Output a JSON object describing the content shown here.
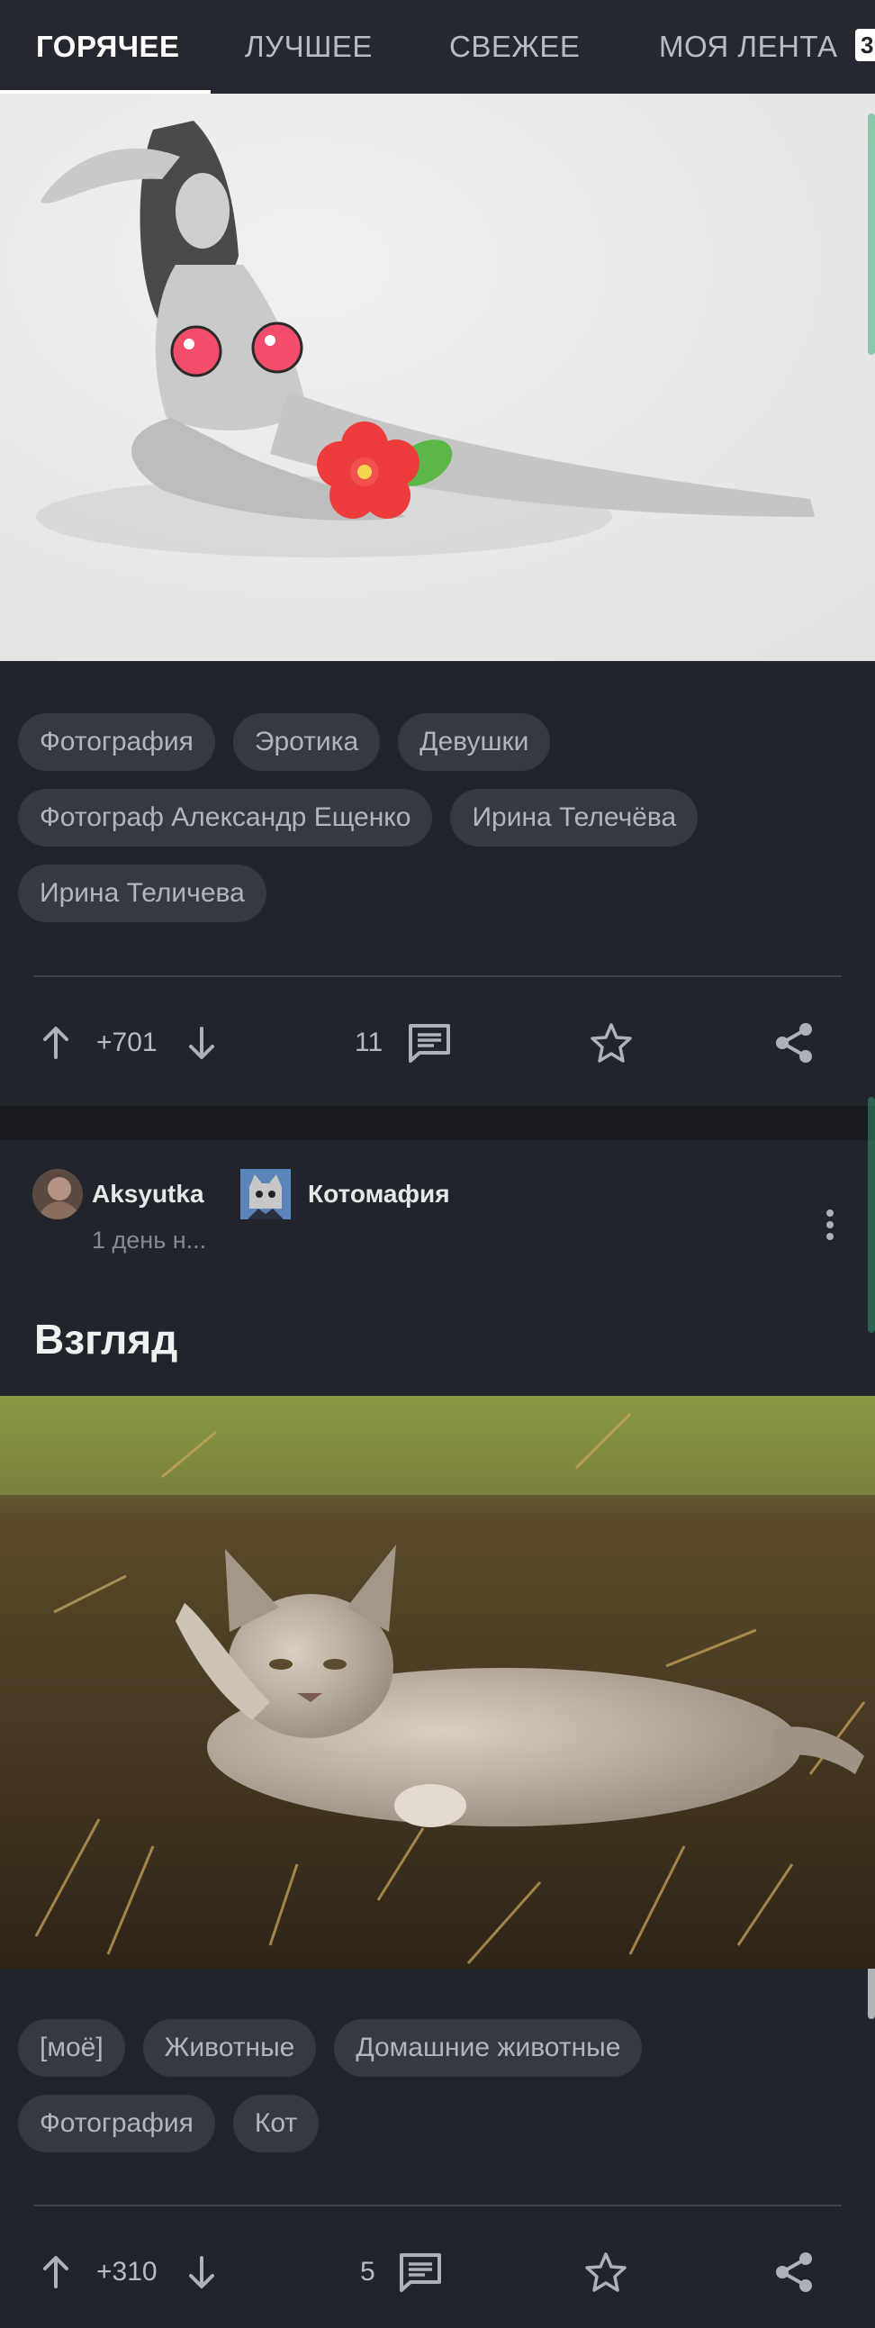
{
  "tabs": [
    {
      "label": "ГОРЯЧЕЕ",
      "active": true
    },
    {
      "label": "ЛУЧШЕЕ",
      "active": false
    },
    {
      "label": "СВЕЖЕЕ",
      "active": false
    },
    {
      "label": "МОЯ ЛЕНТА",
      "active": false
    }
  ],
  "tab_badge": "3",
  "posts": [
    {
      "tags": [
        "Фотография",
        "Эротика",
        "Девушки",
        "Фотограф Александр Ещенко",
        "Ирина Телечёва",
        "Ирина Теличева"
      ],
      "rating": "+701",
      "comments": "11"
    },
    {
      "author": "Aksyutka",
      "community": "Котомафия",
      "time": "1 день н...",
      "title": "Взгляд",
      "tags": [
        "[моё]",
        "Животные",
        "Домашние животные",
        "Фотография",
        "Кот"
      ],
      "rating": "+310",
      "comments": "5"
    }
  ],
  "icons": {
    "upvote": "arrow-up-icon",
    "downvote": "arrow-down-icon",
    "comments": "comment-icon",
    "favorite": "star-icon",
    "share": "share-icon",
    "more": "more-vertical-icon"
  },
  "colors": {
    "background": "#21252b",
    "tag_bg": "#353a41",
    "accent_green": "#3fae76"
  }
}
